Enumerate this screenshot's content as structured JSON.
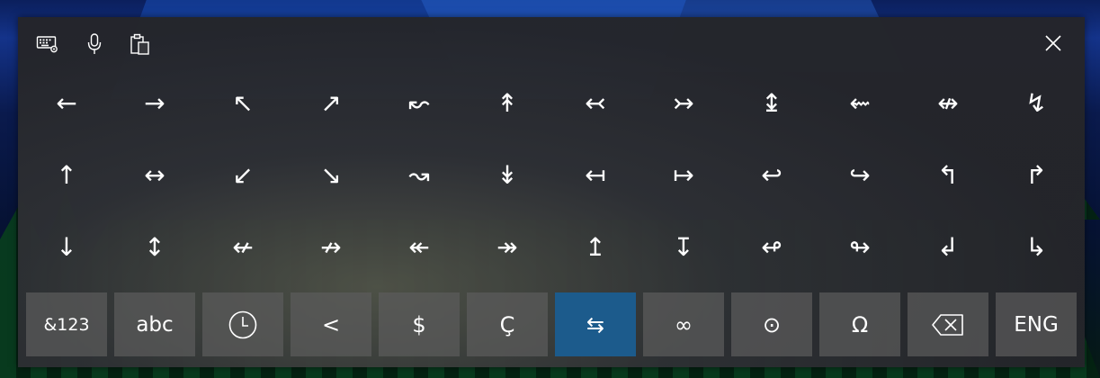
{
  "colors": {
    "panel_bg": "#2e3034",
    "key_bg": "#5c5c5c",
    "active_key_bg": "#1c5b8c",
    "text": "#ffffff"
  },
  "toolbar": {
    "icons": [
      "keyboard-settings-icon",
      "microphone-icon",
      "clipboard-icon"
    ],
    "close_icon": "close-icon"
  },
  "symbol_rows": [
    [
      "←",
      "→",
      "↖",
      "↗",
      "↜",
      "↟",
      "↢",
      "↣",
      "↨",
      "⇜",
      "↮",
      "↯"
    ],
    [
      "↑",
      "↔",
      "↙",
      "↘",
      "↝",
      "↡",
      "↤",
      "↦",
      "↩",
      "↪",
      "↰",
      "↱"
    ],
    [
      "↓",
      "↕",
      "↚",
      "↛",
      "↞",
      "↠",
      "↥",
      "↧",
      "↫",
      "↬",
      "↲",
      "↳"
    ]
  ],
  "bottom_keys": [
    {
      "label": "&123",
      "name": "numbers-key"
    },
    {
      "label": "abc",
      "name": "letters-key"
    },
    {
      "label": "",
      "name": "recent-clock-key",
      "icon": "clock-icon"
    },
    {
      "label": "<",
      "name": "symbol-category-lt-key"
    },
    {
      "label": "$",
      "name": "symbol-category-currency-key"
    },
    {
      "label": "Ç",
      "name": "symbol-category-accented-key"
    },
    {
      "label": "⇆",
      "name": "symbol-category-arrows-key",
      "active": true
    },
    {
      "label": "∞",
      "name": "symbol-category-math-key"
    },
    {
      "label": "⊙",
      "name": "symbol-category-misc-key"
    },
    {
      "label": "Ω",
      "name": "symbol-category-greek-key"
    },
    {
      "label": "",
      "name": "backspace-key",
      "icon": "backspace-icon"
    },
    {
      "label": "ENG",
      "name": "language-key"
    }
  ]
}
